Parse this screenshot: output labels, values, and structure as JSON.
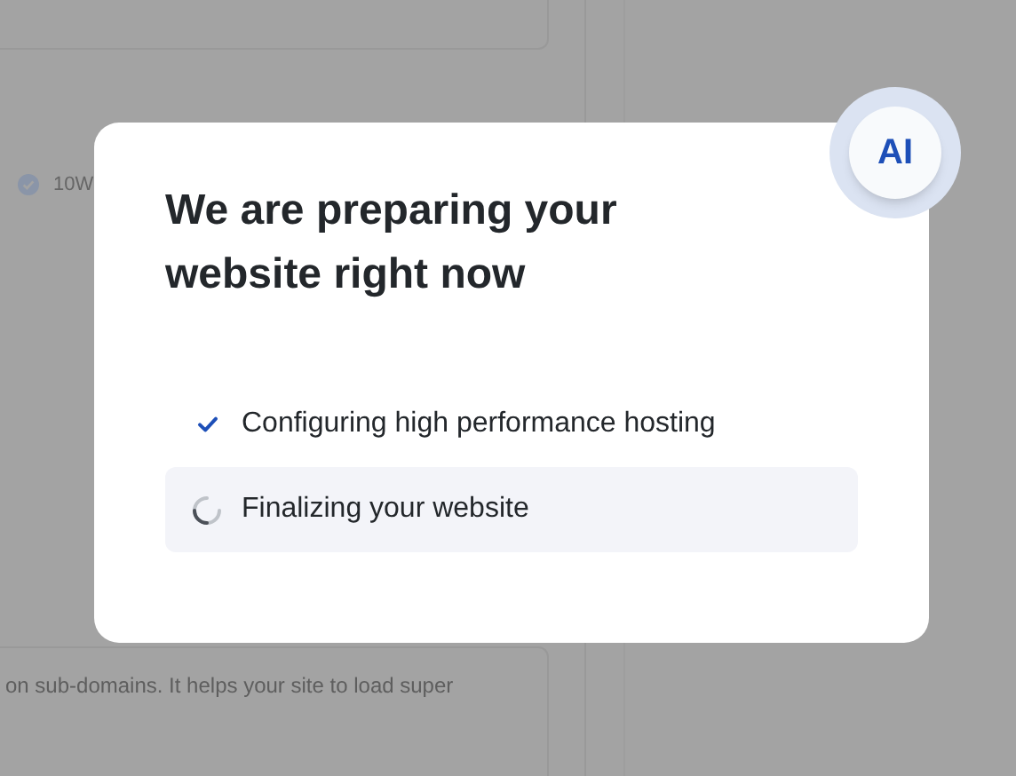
{
  "background": {
    "feature_label": "10W",
    "description": "on sub-domains. It helps your site to load super"
  },
  "dialog": {
    "badge": "AI",
    "title": "We are preparing your website right now",
    "steps": [
      {
        "label": "Configuring high performance hosting",
        "kind": "done"
      },
      {
        "label": "Finalizing your website",
        "kind": "loading"
      }
    ]
  }
}
